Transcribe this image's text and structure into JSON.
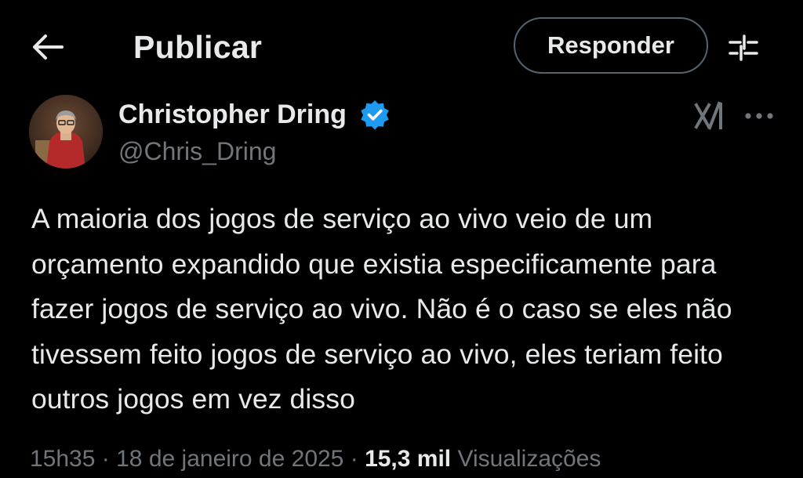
{
  "header": {
    "back_icon": "arrow-left-icon",
    "title": "Publicar",
    "reply_label": "Responder",
    "filter_icon": "sliders-icon"
  },
  "tweet": {
    "author_name": "Christopher Dring",
    "author_handle": "@Chris_Dring",
    "verified_icon": "verified-badge-icon",
    "verified_color": "#1d9bf0",
    "grok_icon": "grok-icon",
    "more_icon": "more-horizontal-icon",
    "text": "A maioria dos jogos de serviço ao vivo veio de um orçamento expandido que existia especificamente para fazer jogos de serviço ao vivo. Não é o caso se eles não tivessem feito jogos de serviço ao vivo, eles teriam feito outros jogos em vez disso",
    "time": "15h35",
    "separator": "·",
    "date": "18 de janeiro de 2025",
    "views_count": "15,3 mil",
    "views_label": "Visualizações"
  },
  "colors": {
    "background": "#000000",
    "text_primary": "#e7e9ea",
    "text_secondary": "#71767b",
    "border": "#536471",
    "accent": "#1d9bf0"
  }
}
